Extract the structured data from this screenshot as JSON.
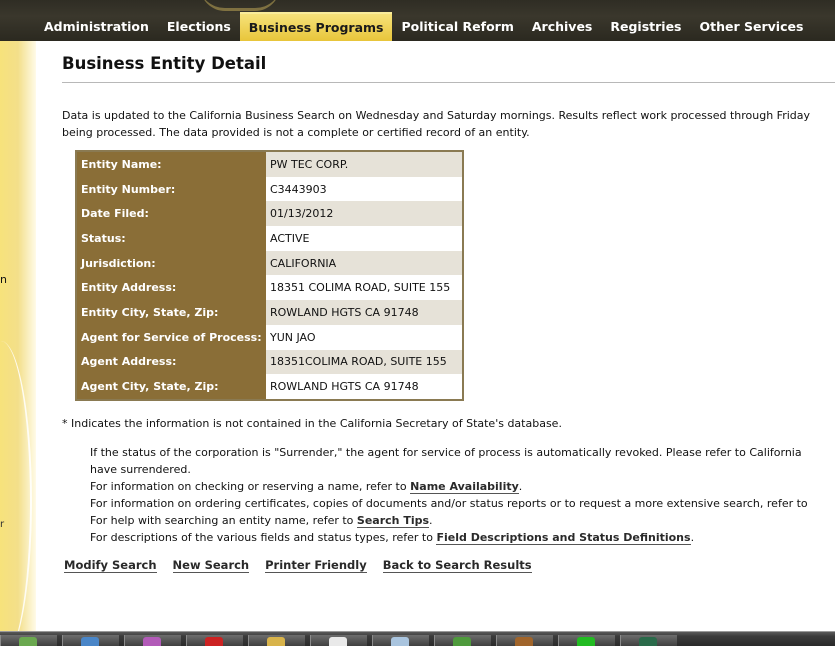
{
  "nav": {
    "items": [
      "Administration",
      "Elections",
      "Business Programs",
      "Political Reform",
      "Archives",
      "Registries",
      "Other Services"
    ],
    "active": "Business Programs"
  },
  "page": {
    "title": "Business Entity Detail",
    "intro_line1": "Data is updated to the California Business Search on Wednesday and Saturday mornings. Results reflect work processed through Friday",
    "intro_line2": "being processed. The data provided is not a complete or certified record of an entity."
  },
  "entity": {
    "rows": [
      {
        "label": "Entity Name:",
        "value": "PW TEC CORP."
      },
      {
        "label": "Entity Number:",
        "value": "C3443903"
      },
      {
        "label": "Date Filed:",
        "value": "01/13/2012"
      },
      {
        "label": "Status:",
        "value": "ACTIVE"
      },
      {
        "label": "Jurisdiction:",
        "value": "CALIFORNIA"
      },
      {
        "label": "Entity Address:",
        "value": "18351 COLIMA ROAD, SUITE 155"
      },
      {
        "label": "Entity City, State, Zip:",
        "value": "ROWLAND HGTS CA 91748"
      },
      {
        "label": "Agent for Service of Process:",
        "value": "YUN JAO"
      },
      {
        "label": "Agent Address:",
        "value": "18351COLIMA ROAD, SUITE 155"
      },
      {
        "label": "Agent City, State, Zip:",
        "value": "ROWLAND HGTS CA 91748"
      }
    ]
  },
  "note": "* Indicates the information is not contained in the California Secretary of State's database.",
  "info": {
    "surrender_1": "If the status of the corporation is \"Surrender,\" the agent for service of process is automatically revoked. Please refer to California",
    "surrender_2": "have surrendered.",
    "name_pre": "For information on checking or reserving a name, refer to ",
    "name_link": "Name Availability",
    "name_post": ".",
    "order_text": "For information on ordering certificates, copies of documents and/or status reports or to request a more extensive search, refer to",
    "tips_pre": "For help with searching an entity name, refer to ",
    "tips_link": "Search Tips",
    "tips_post": ".",
    "desc_pre": "For descriptions of the various fields and status types, refer to ",
    "desc_link": "Field Descriptions and Status Definitions",
    "desc_post": "."
  },
  "actions": {
    "modify": "Modify Search",
    "new": "New Search",
    "printer": "Printer Friendly",
    "back": "Back to Search Results"
  },
  "left_fragments": {
    "a": "n",
    "b": "r"
  },
  "colors": {
    "nav_bg": "#2f2d24",
    "nav_active": "#f0d24f",
    "label_bg": "#8a6e37",
    "row_shade": "#e6e2d8",
    "side_panel": "#f7e27b"
  },
  "taskbar": {
    "icons": [
      "app-icon",
      "ie-icon",
      "color-icon",
      "red-icon",
      "folder-icon",
      "network-icon",
      "file-icon",
      "spreadsheet-icon",
      "cup-icon",
      "green-arrow-icon",
      "window-icon"
    ]
  }
}
